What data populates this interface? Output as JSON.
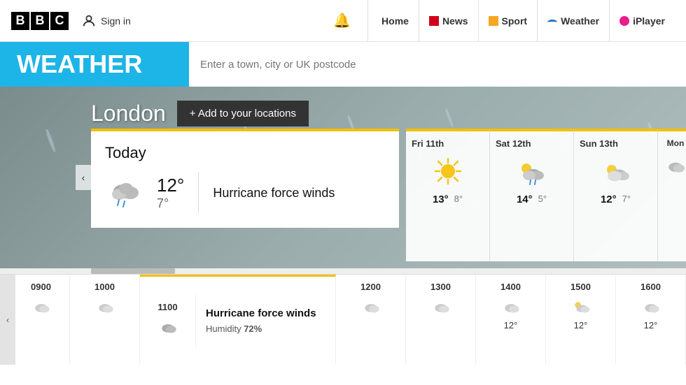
{
  "header": {
    "logo": "BBC",
    "logo_letters": [
      "B",
      "B",
      "C"
    ],
    "sign_in": "Sign in",
    "bell_label": "Notifications",
    "nav": [
      {
        "label": "Home",
        "color": "transparent",
        "icon": "home-icon"
      },
      {
        "label": "News",
        "color": "#d0021b",
        "icon": "news-icon"
      },
      {
        "label": "Sport",
        "color": "#f5a623",
        "icon": "sport-icon"
      },
      {
        "label": "Weather",
        "color": "#1e73be",
        "icon": "weather-icon"
      },
      {
        "label": "iPlayer",
        "color": "#e91e8c",
        "icon": "iplayer-icon"
      }
    ]
  },
  "weather_bar": {
    "title": "WEATHER",
    "search_placeholder": "Enter a town, city or UK postcode"
  },
  "hero": {
    "location": "London",
    "add_btn": "+ Add to your locations"
  },
  "today": {
    "label": "Today",
    "temp_high": "12°",
    "temp_low": "7°",
    "description": "Hurricane force winds"
  },
  "forecast": [
    {
      "date": "Fri 11th",
      "temp_high": "13°",
      "temp_low": "8°",
      "type": "sunny"
    },
    {
      "date": "Sat 12th",
      "temp_high": "14°",
      "temp_low": "5°",
      "type": "cloud-rain"
    },
    {
      "date": "Sun 13th",
      "temp_high": "12°",
      "temp_low": "7°",
      "type": "cloudy"
    },
    {
      "date": "Mon",
      "temp_high": "",
      "temp_low": "",
      "type": "partial"
    }
  ],
  "hourly": {
    "times": [
      "0900",
      "1000",
      "1100",
      "1200",
      "1300",
      "1400",
      "1500",
      "1600"
    ],
    "active_index": 2,
    "active_label": "Hurricane force winds",
    "active_humidity": "Humidity",
    "active_humidity_val": "72%",
    "temps": [
      "",
      "",
      "",
      "",
      "",
      "12°",
      "12°",
      "12°"
    ]
  }
}
